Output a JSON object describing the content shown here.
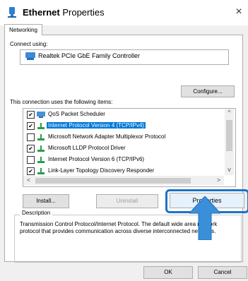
{
  "window": {
    "title_bold": "Ethernet",
    "title_rest": " Properties",
    "close_glyph": "×"
  },
  "tabs": {
    "networking": "Networking"
  },
  "connect_using_label": "Connect using:",
  "adapter_name": "Realtek PCIe GbE Family Controller",
  "configure_label": "Configure...",
  "items_label": "This connection uses the following items:",
  "items": [
    {
      "label": "QoS Packet Scheduler",
      "checked": true
    },
    {
      "label": "Internet Protocol Version 4 (TCP/IPv4)",
      "checked": true,
      "selected": true
    },
    {
      "label": "Microsoft Network Adapter Multiplexor Protocol",
      "checked": false
    },
    {
      "label": "Microsoft LLDP Protocol Driver",
      "checked": true
    },
    {
      "label": "Internet Protocol Version 6 (TCP/IPv6)",
      "checked": false
    },
    {
      "label": "Link-Layer Topology Discovery Responder",
      "checked": true
    }
  ],
  "buttons": {
    "install": "Install...",
    "uninstall": "Uninstall",
    "properties": "Properties",
    "ok": "OK",
    "cancel": "Cancel"
  },
  "description": {
    "title": "Description",
    "text": "Transmission Control Protocol/Internet Protocol. The default wide area network protocol that provides communication across diverse interconnected networks."
  },
  "icons": {
    "title": "network-adapter-icon",
    "close": "close-icon",
    "arrow": "up-arrow-icon"
  },
  "colors": {
    "selection": "#0078d7",
    "highlight": "#1b73c8",
    "arrow": "#3a8fd8"
  }
}
